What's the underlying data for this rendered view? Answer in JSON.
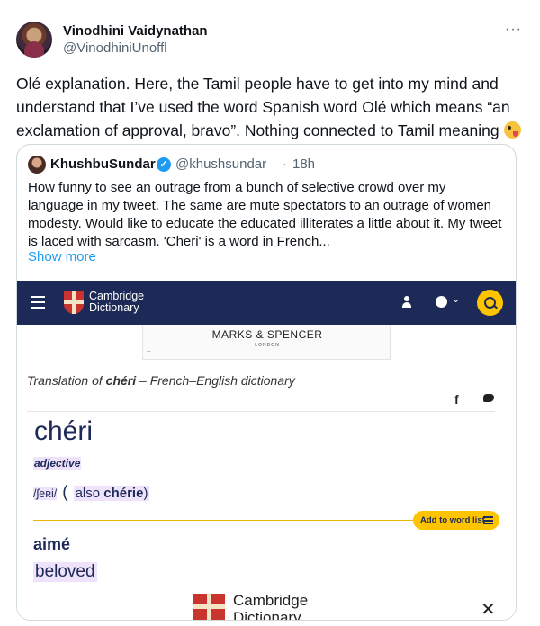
{
  "tweet": {
    "display_name": "Vinodhini Vaidynathan",
    "handle": "@VinodhiniUnoffl",
    "more_icon": "···",
    "text": "Olé explanation. Here, the Tamil people have to get into my mind and understand that I’ve used the word Spanish word Olé which means “an exclamation of approval, bravo”. Nothing connected to Tamil meaning"
  },
  "quote": {
    "display_name": "KhushbuSundar",
    "verified_icon": "✓",
    "handle": "@khushsundar",
    "separator": "·",
    "time": "18h",
    "text": "How funny to see an outrage from a bunch of selective crowd over my language in my tweet. The same are mute spectators to an outrage of women modesty. Would like to educate the educated illiterates a little about it. My tweet is laced with sarcasm. 'Cheri' is a word in French...",
    "show_more": "Show more"
  },
  "cambridge": {
    "nav_title_line1": "Cambridge",
    "nav_title_line2": "Dictionary",
    "chevron": "⌄",
    "ad_text": "MARKS & SPENCER",
    "ad_sub": "LONDON",
    "ad_mark": "=",
    "translation_prefix": "Translation of ",
    "translation_word": "chéri",
    "translation_suffix": " – French–English dictionary",
    "facebook_icon": "f",
    "headword": "chéri",
    "part_of_speech": "adjective",
    "pronunciation": "/ʃeʀi/",
    "paren_open": "(",
    "also_label": "also ",
    "also_word": "chérie",
    "paren_close": ")",
    "add_to_word_list": "Add to word list",
    "translation_headword": "aimé",
    "translation_meaning": "beloved",
    "banner_line1": "Cambridge",
    "banner_line2": "Dictionary",
    "close_icon": "✕"
  },
  "colors": {
    "cambridge_navy": "#1d2a57",
    "cambridge_yellow": "#fec400",
    "twitter_blue": "#1d9bf0"
  }
}
